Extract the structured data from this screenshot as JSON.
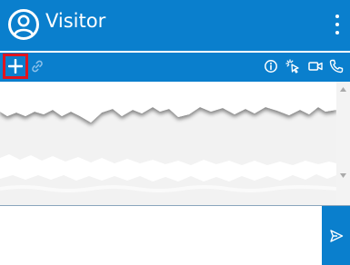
{
  "header": {
    "title": "Visitor",
    "avatar_icon": "user-circle-icon",
    "menu_icon": "more-vertical-icon"
  },
  "toolbar": {
    "left_tools": [
      {
        "name": "add-icon"
      },
      {
        "name": "link-icon"
      }
    ],
    "right_tools": [
      {
        "name": "info-icon"
      },
      {
        "name": "cursor-click-icon"
      },
      {
        "name": "video-icon"
      },
      {
        "name": "phone-icon"
      }
    ]
  },
  "composer": {
    "message_value": "",
    "send_icon": "send-icon"
  },
  "colors": {
    "brand": "#0a7fcd",
    "highlight": "#e0141e",
    "chat_background": "#ffffff",
    "scrollbar": "#f3f3f3"
  }
}
